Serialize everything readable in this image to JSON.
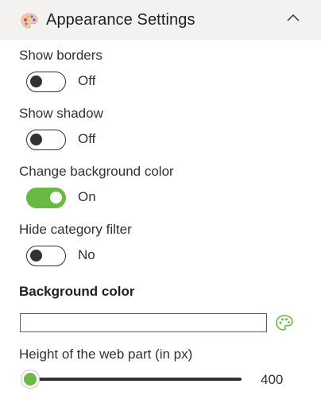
{
  "header": {
    "title": "Appearance Settings",
    "icon": "palette-icon",
    "collapse_icon": "chevron-up-icon"
  },
  "toggles": [
    {
      "label": "Show borders",
      "state_text": "Off",
      "on": false
    },
    {
      "label": "Show shadow",
      "state_text": "Off",
      "on": false
    },
    {
      "label": "Change background color",
      "state_text": "On",
      "on": true
    },
    {
      "label": "Hide category filter",
      "state_text": "No",
      "on": false
    }
  ],
  "background_color": {
    "section_title": "Background color",
    "value": "",
    "picker_icon": "palette-icon"
  },
  "height": {
    "label": "Height of the web part (in px)",
    "value": "400",
    "fraction": 0.0
  },
  "colors": {
    "accent": "#6bb945",
    "header_bg": "#f3f2f1",
    "text": "#323130"
  }
}
